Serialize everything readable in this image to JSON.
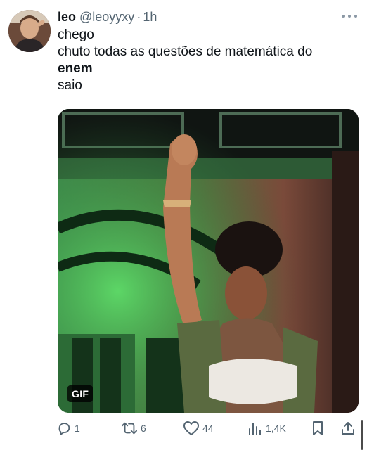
{
  "tweet": {
    "display_name": "leo",
    "handle": "@leoyyxy",
    "separator": "·",
    "time": "1h",
    "lines": [
      "chego",
      "chuto todas as questões de matemática do",
      "enem",
      "saio"
    ],
    "media": {
      "badge": "GIF"
    },
    "actions": {
      "replies": "1",
      "retweets": "6",
      "likes": "44",
      "views": "1,4K"
    }
  },
  "icons": {
    "more": "more-dots-icon",
    "reply": "reply-icon",
    "retweet": "retweet-icon",
    "like": "heart-icon",
    "views": "views-icon",
    "bookmark": "bookmark-icon",
    "share": "share-icon"
  },
  "colors": {
    "text": "#0f1419",
    "secondary": "#536471",
    "gif_badge_bg": "#000000"
  }
}
